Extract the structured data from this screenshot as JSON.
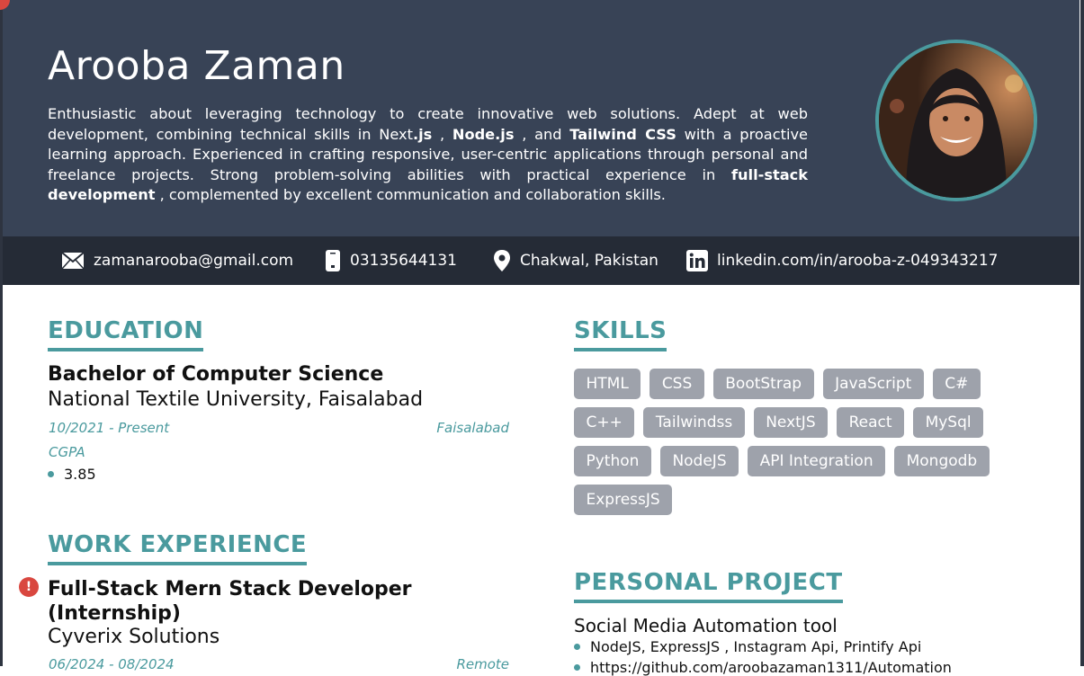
{
  "header": {
    "name": "Arooba Zaman",
    "summary": {
      "p1": "Enthusiastic about leveraging technology to create innovative web solutions. Adept at web development, combining technical skills in Next",
      "b1": ".js",
      "p2": " , ",
      "b2": "Node.js",
      "p3": " , and ",
      "b3": "Tailwind CSS",
      "p4": " with a proactive learning approach. Experienced in crafting responsive, user-centric applications through personal and freelance projects. Strong problem-solving abilities with practical experience in ",
      "b4": "full-stack development",
      "p5": " , complemented by excellent communication and collaboration skills."
    }
  },
  "contact": {
    "email": "zamanarooba@gmail.com",
    "phone": "03135644131",
    "location": "Chakwal, Pakistan",
    "linkedin": "linkedin.com/in/arooba-z-049343217"
  },
  "education": {
    "heading": "EDUCATION",
    "degree": "Bachelor of Computer Science",
    "school": "National Textile University, Faisalabad",
    "dates": "10/2021 - Present",
    "location": "Faisalabad",
    "cgpa_label": "CGPA",
    "cgpa_value": "3.85"
  },
  "work": {
    "heading": "WORK EXPERIENCE",
    "title": "Full-Stack Mern Stack Developer (Internship)",
    "company": "Cyverix Solutions",
    "dates": "06/2024 - 08/2024",
    "location": "Remote"
  },
  "skills": {
    "heading": "SKILLS",
    "items": [
      "HTML",
      "CSS",
      "BootStrap",
      "JavaScript",
      "C#",
      "C++",
      "Tailwindss",
      "NextJS",
      "React",
      "MySql",
      "Python",
      "NodeJS",
      "API Integration",
      "Mongodb",
      "ExpressJS"
    ]
  },
  "project": {
    "heading": "PERSONAL PROJECT",
    "title": "Social Media Automation tool",
    "stack": "NodeJS, ExpressJS , Instagram Api, Printify Api",
    "link": "https://github.com/aroobazaman1311/Automation"
  },
  "colors": {
    "header_bg": "#384356",
    "contact_bg": "#252b36",
    "accent": "#4a9a9e",
    "skill_chip": "#9ea2ab"
  }
}
